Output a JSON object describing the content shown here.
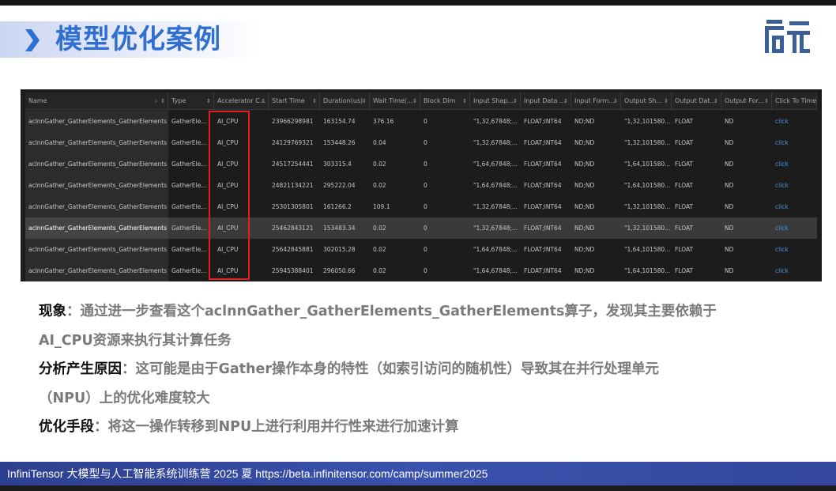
{
  "slide": {
    "title": "模型优化案例",
    "logo": "启元"
  },
  "table": {
    "columns": [
      "Name",
      "Type",
      "Accelerator C...",
      "Start Time",
      "Duration(us)",
      "Wait Time(...",
      "Block Dim",
      "Input Shap...",
      "Input Data ...",
      "Input Form...",
      "Output Sh...",
      "Output Dat...",
      "Output For...",
      "Click To Time..."
    ],
    "rows": [
      [
        "aclnnGather_GatherElements_GatherElements",
        "GatherEle...",
        "AI_CPU",
        "23966298981",
        "163154.74",
        "376.16",
        "0",
        "\"1,32,67848;...",
        "FLOAT;INT64",
        "ND;ND",
        "\"1,32,101580...",
        "FLOAT",
        "ND",
        "click"
      ],
      [
        "aclnnGather_GatherElements_GatherElements",
        "GatherEle...",
        "AI_CPU",
        "24129769321",
        "153448.26",
        "0.04",
        "0",
        "\"1,32,67848;...",
        "FLOAT;INT64",
        "ND;ND",
        "\"1,32,101580...",
        "FLOAT",
        "ND",
        "click"
      ],
      [
        "aclnnGather_GatherElements_GatherElements",
        "GatherEle...",
        "AI_CPU",
        "24517254441",
        "303315.4",
        "0.02",
        "0",
        "\"1,64,67848;...",
        "FLOAT;INT64",
        "ND;ND",
        "\"1,64,101580...",
        "FLOAT",
        "ND",
        "click"
      ],
      [
        "aclnnGather_GatherElements_GatherElements",
        "GatherEle...",
        "AI_CPU",
        "24821134221",
        "295222.04",
        "0.02",
        "0",
        "\"1,64,67848;...",
        "FLOAT;INT64",
        "ND;ND",
        "\"1,64,101580...",
        "FLOAT",
        "ND",
        "click"
      ],
      [
        "aclnnGather_GatherElements_GatherElements",
        "GatherEle...",
        "AI_CPU",
        "25301305801",
        "161266.2",
        "109.1",
        "0",
        "\"1,32,67848;...",
        "FLOAT;INT64",
        "ND;ND",
        "\"1,32,101580...",
        "FLOAT",
        "ND",
        "click"
      ],
      [
        "aclnnGather_GatherElements_GatherElements",
        "GatherEle...",
        "AI_CPU",
        "25462843121",
        "153483.34",
        "0.02",
        "0",
        "\"1,32,67848;...",
        "FLOAT;INT64",
        "ND;ND",
        "\"1,32,101580...",
        "FLOAT",
        "ND",
        "click"
      ],
      [
        "aclnnGather_GatherElements_GatherElements",
        "GatherEle...",
        "AI_CPU",
        "25642845881",
        "302015.28",
        "0.02",
        "0",
        "\"1,64,67848;...",
        "FLOAT;INT64",
        "ND;ND",
        "\"1,64,101580...",
        "FLOAT",
        "ND",
        "click"
      ],
      [
        "aclnnGather_GatherElements_GatherElements",
        "GatherEle...",
        "AI_CPU",
        "25945388401",
        "296050.66",
        "0.02",
        "0",
        "\"1,64,67848;...",
        "FLOAT;INT64",
        "ND;ND",
        "\"1,64,101580...",
        "FLOAT",
        "ND",
        "click"
      ]
    ],
    "selected_row": 5,
    "highlight_color": "#e02020",
    "link_color": "#4d8fe6"
  },
  "text": {
    "p1_key": "现象",
    "p1_body": "：通过进一步查看这个aclnnGather_GatherElements_GatherElements算子，发现其主要依赖于",
    "p1_cont": "AI_CPU资源来执行其计算任务",
    "p2_key": "分析产生原因",
    "p2_body": "：这可能是由于Gather操作本身的特性（如索引访问的随机性）导致其在并行处理单元",
    "p2_cont": "（NPU）上的优化难度较大",
    "p3_key": "优化手段",
    "p3_body": "：将这一操作转移到NPU上进行利用并行性来进行加速计算"
  },
  "footer": {
    "text": "InfiniTensor 大模型与人工智能系统训练营 2025 夏    https://beta.infinitensor.com/camp/summer2025"
  },
  "colors": {
    "title_blue": "#2f6fd1",
    "footer_blue": "#3a52ad"
  }
}
